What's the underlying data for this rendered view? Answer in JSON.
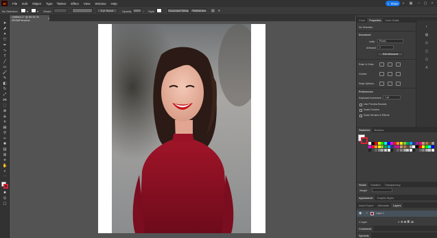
{
  "menubar": {
    "app_logo": "Ai",
    "items": [
      "File",
      "Edit",
      "Object",
      "Type",
      "Select",
      "Effect",
      "View",
      "Window",
      "Help"
    ],
    "share_label": "Share"
  },
  "controlbar": {
    "selection": "No Selection",
    "stroke_label": "Stroke",
    "brush_label": "5 pt. Round",
    "opacity_label": "Opacity",
    "opacity_value": "100%",
    "style_label": "Style",
    "doc_setup_label": "Document Setup",
    "preferences_label": "Preferences"
  },
  "tab": {
    "title": "Untitled-1* @ 89.52 % (RGB/Preview)",
    "close": "×"
  },
  "panel": {
    "top_tabs": [
      "Color",
      "Properties",
      "Color Guide"
    ],
    "no_selection": "No Selection",
    "document_heading": "Document",
    "units_label": "Units",
    "units_value": "Pixels",
    "artboard_label": "Artboard",
    "artboard_value": "1",
    "edit_artboards": "Edit Artboards",
    "rulers_label": "Ruler & Grids",
    "guides_label": "Guides",
    "snap_label": "Snap Options",
    "preferences_heading": "Preferences",
    "keyboard_increment_label": "Keyboard Increment:",
    "keyboard_increment_value": "1 pt",
    "checkboxes": [
      "Use Preview Bounds",
      "Scale Corners",
      "Scale Strokes & Effects"
    ],
    "swatches_tabs": [
      "Swatches",
      "Brushes"
    ],
    "stroke_tabs": [
      "Stroke",
      "Gradient",
      "Transparency"
    ],
    "weight_label": "Weight",
    "appearance_tabs": [
      "Appearance",
      "Graphic Styles"
    ],
    "layers_tabs": [
      "Asset Export",
      "Artboards",
      "Layers"
    ],
    "layer_name": "Layer 1",
    "layer_count": "1 Layer",
    "comments": "Comments",
    "symbols": "Symbols"
  },
  "colors": {
    "accent": "#1473e6",
    "dress": "#8e1024",
    "lips": "#c4161c"
  }
}
